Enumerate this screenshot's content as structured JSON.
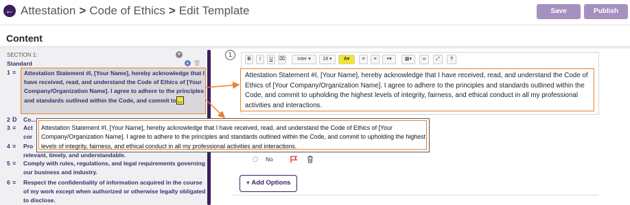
{
  "header": {
    "back_icon": "arrow-left-icon",
    "breadcrumb": [
      "Attestation",
      "Code of Ethics",
      "Edit Template"
    ],
    "separator": ">",
    "save_label": "Save",
    "publish_label": "Publish"
  },
  "content_title": "Content",
  "section": {
    "label": "SECTION 1:",
    "name": "Standard"
  },
  "questions": [
    {
      "num": "1",
      "text": "Attestation Statement #I, [Your Name], hereby acknowledge that I have received, read, and understand the Code of Ethics of [Your Company/Organization Name]. I agree to adhere to the principles and standards outlined within the Code, and commit to",
      "ellipsis": "..."
    },
    {
      "num": "2",
      "text": "Co..."
    },
    {
      "num": "3",
      "text": "Act",
      "text2": "cor"
    },
    {
      "num": "4",
      "text": "Pro",
      "text2": "relevant, timely, and understandable."
    },
    {
      "num": "5",
      "text": "Comply with rules, regulations, and legal requirements governing our business and industry."
    },
    {
      "num": "6",
      "text": "Respect the confidentiality of information acquired in the course of my work except when authorized or otherwise legally obligated to disclose."
    }
  ],
  "question_number": "1",
  "toolbar": {
    "bold": "B",
    "italic": "I",
    "underline": "U",
    "font": "Inter",
    "size": "18",
    "color": "A",
    "help": "?"
  },
  "editor_text": "Attestation Statement #I, [Your Name], hereby acknowledge that I have received, read, and understand the Code of Ethics of [Your Company/Organization Name]. I agree to adhere to the principles and standards outlined within the Code, and commit to upholding the highest levels of integrity, fairness, and ethical conduct in all my professional activities and interactions.",
  "tooltip_text": "Attestation Statement  #I, [Your Name], hereby acknowledge that I have received, read, and understand the Code of Ethics of [Your Company/Organization Name]. I agree to adhere to the principles and standards outlined within the Code, and commit to upholding the highest levels of integrity, fairness, and ethical conduct in all my professional activities and interactions.",
  "options": {
    "no_label": "No",
    "add_options_label": "+ Add Options"
  },
  "colors": {
    "brand": "#3b1f5d",
    "button_disabled": "#a590bf",
    "highlight_border": "#e8822e",
    "highlight_text_bg": "#f4e532"
  }
}
